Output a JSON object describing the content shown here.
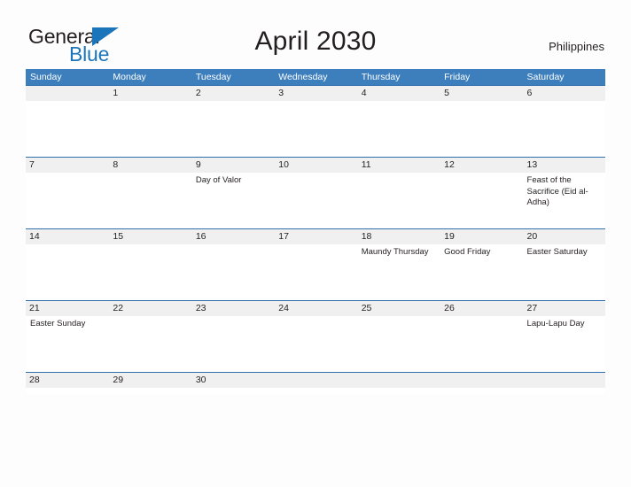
{
  "brand": {
    "name_part1": "General",
    "name_part2": "Blue",
    "accent_color": "#1b75bb"
  },
  "header": {
    "title": "April 2030",
    "country": "Philippines"
  },
  "calendar": {
    "header_color": "#3d7ebd",
    "band_color": "#f0f0f0",
    "weekdays": [
      "Sunday",
      "Monday",
      "Tuesday",
      "Wednesday",
      "Thursday",
      "Friday",
      "Saturday"
    ],
    "weeks": [
      {
        "days": [
          {
            "num": "",
            "event": ""
          },
          {
            "num": "1",
            "event": ""
          },
          {
            "num": "2",
            "event": ""
          },
          {
            "num": "3",
            "event": ""
          },
          {
            "num": "4",
            "event": ""
          },
          {
            "num": "5",
            "event": ""
          },
          {
            "num": "6",
            "event": ""
          }
        ]
      },
      {
        "days": [
          {
            "num": "7",
            "event": ""
          },
          {
            "num": "8",
            "event": ""
          },
          {
            "num": "9",
            "event": "Day of Valor"
          },
          {
            "num": "10",
            "event": ""
          },
          {
            "num": "11",
            "event": ""
          },
          {
            "num": "12",
            "event": ""
          },
          {
            "num": "13",
            "event": "Feast of the Sacrifice (Eid al-Adha)"
          }
        ]
      },
      {
        "days": [
          {
            "num": "14",
            "event": ""
          },
          {
            "num": "15",
            "event": ""
          },
          {
            "num": "16",
            "event": ""
          },
          {
            "num": "17",
            "event": ""
          },
          {
            "num": "18",
            "event": "Maundy Thursday"
          },
          {
            "num": "19",
            "event": "Good Friday"
          },
          {
            "num": "20",
            "event": "Easter Saturday"
          }
        ]
      },
      {
        "days": [
          {
            "num": "21",
            "event": "Easter Sunday"
          },
          {
            "num": "22",
            "event": ""
          },
          {
            "num": "23",
            "event": ""
          },
          {
            "num": "24",
            "event": ""
          },
          {
            "num": "25",
            "event": ""
          },
          {
            "num": "26",
            "event": ""
          },
          {
            "num": "27",
            "event": "Lapu-Lapu Day"
          }
        ]
      },
      {
        "days": [
          {
            "num": "28",
            "event": ""
          },
          {
            "num": "29",
            "event": ""
          },
          {
            "num": "30",
            "event": ""
          },
          {
            "num": "",
            "event": ""
          },
          {
            "num": "",
            "event": ""
          },
          {
            "num": "",
            "event": ""
          },
          {
            "num": "",
            "event": ""
          }
        ]
      }
    ]
  }
}
